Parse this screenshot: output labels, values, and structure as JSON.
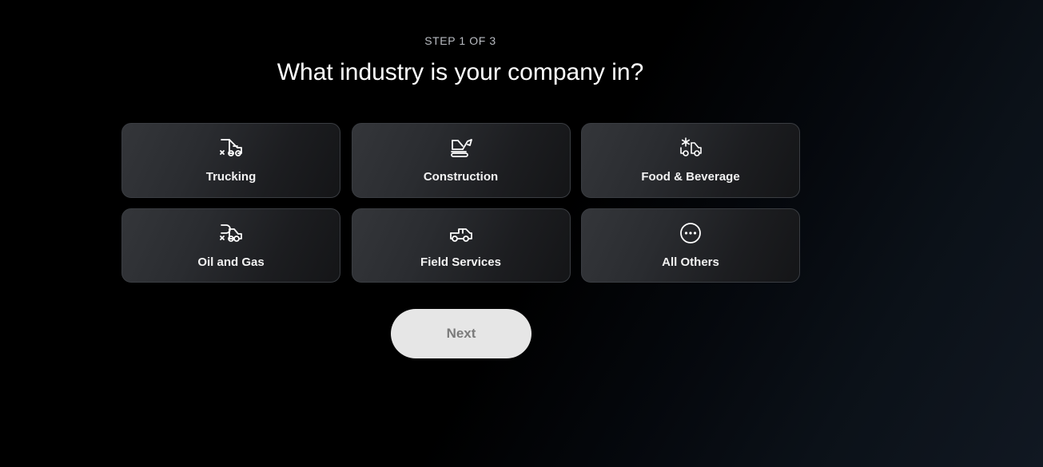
{
  "step_label": "STEP 1 OF 3",
  "question": "What industry is your company in?",
  "industries": [
    {
      "label": "Trucking",
      "icon": "truck-icon"
    },
    {
      "label": "Construction",
      "icon": "excavator-icon"
    },
    {
      "label": "Food & Beverage",
      "icon": "refrigerated-truck-icon"
    },
    {
      "label": "Oil and Gas",
      "icon": "tanker-truck-icon"
    },
    {
      "label": "Field Services",
      "icon": "pickup-truck-icon"
    },
    {
      "label": "All Others",
      "icon": "more-dots-icon"
    }
  ],
  "next_button": {
    "label": "Next",
    "state": "disabled"
  },
  "colors": {
    "background": "#000000",
    "card_background": "#2a2c30",
    "card_border": "#3a3d42",
    "button_background": "#e6e6e6",
    "button_text": "#7b7b7b"
  }
}
